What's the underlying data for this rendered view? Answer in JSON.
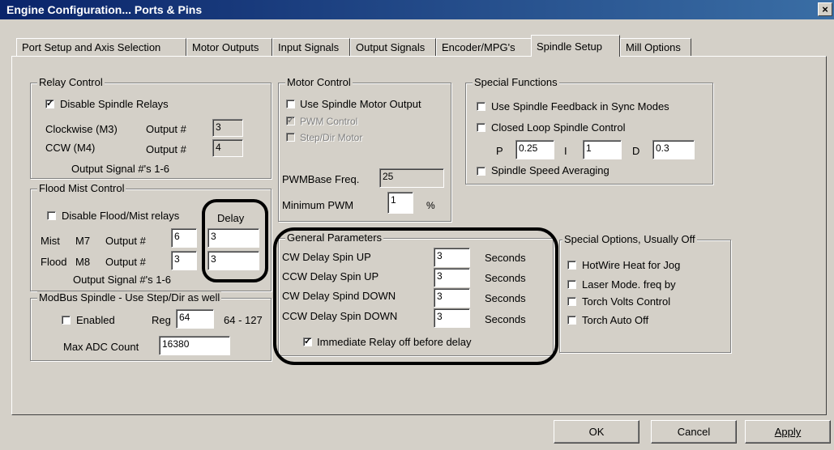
{
  "window": {
    "title": "Engine Configuration... Ports & Pins",
    "close": "×"
  },
  "tabs": [
    {
      "label": "Port Setup and Axis Selection"
    },
    {
      "label": "Motor Outputs"
    },
    {
      "label": "Input Signals"
    },
    {
      "label": "Output Signals"
    },
    {
      "label": "Encoder/MPG's"
    },
    {
      "label": "Spindle Setup"
    },
    {
      "label": "Mill Options"
    }
  ],
  "relay": {
    "title": "Relay Control",
    "disable_label": "Disable Spindle Relays",
    "disable_checked": true,
    "cw_label": "Clockwise (M3)",
    "ccw_label": "CCW (M4)",
    "output_label": "Output #",
    "cw_output": "3",
    "ccw_output": "4",
    "footer": "Output Signal #'s 1-6"
  },
  "flood": {
    "title": "Flood Mist Control",
    "disable_label": "Disable Flood/Mist relays",
    "disable_checked": false,
    "delay_label": "Delay",
    "mist_label": "Mist",
    "mist_code": "M7",
    "flood_label": "Flood",
    "flood_code": "M8",
    "output_label": "Output #",
    "mist_output": "6",
    "flood_output": "3",
    "mist_delay": "3",
    "flood_delay": "3",
    "footer": "Output Signal #'s 1-6"
  },
  "modbus": {
    "title": "ModBus Spindle - Use Step/Dir as well",
    "enabled_label": "Enabled",
    "enabled_checked": false,
    "reg_label": "Reg",
    "reg_value": "64",
    "reg_range": "64 - 127",
    "adc_label": "Max ADC Count",
    "adc_value": "16380"
  },
  "motor": {
    "title": "Motor Control",
    "use_label": "Use Spindle Motor Output",
    "use_checked": false,
    "pwm_label": "PWM Control",
    "pwm_checked": true,
    "stepdir_label": "Step/Dir Motor",
    "stepdir_checked": false,
    "pwmbase_label": "PWMBase Freq.",
    "pwmbase_value": "25",
    "minpwm_label": "Minimum PWM",
    "minpwm_value": "1",
    "minpwm_unit": "%"
  },
  "special": {
    "title": "Special Functions",
    "feedback_label": "Use Spindle Feedback in Sync Modes",
    "feedback_checked": false,
    "closedloop_label": "Closed Loop Spindle Control",
    "closedloop_checked": false,
    "p_label": "P",
    "p_value": "0.25",
    "i_label": "I",
    "i_value": "1",
    "d_label": "D",
    "d_value": "0.3",
    "averaging_label": "Spindle Speed Averaging",
    "averaging_checked": false
  },
  "general": {
    "title": "General Parameters",
    "rows": [
      {
        "label": "CW Delay Spin UP",
        "value": "3",
        "unit": "Seconds"
      },
      {
        "label": "CCW Delay Spin UP",
        "value": "3",
        "unit": "Seconds"
      },
      {
        "label": "CW Delay Spind DOWN",
        "value": "3",
        "unit": "Seconds"
      },
      {
        "label": "CCW Delay Spin DOWN",
        "value": "3",
        "unit": "Seconds"
      }
    ],
    "immediate_label": "Immediate Relay off before delay",
    "immediate_checked": true
  },
  "options": {
    "title": "Special Options, Usually Off",
    "hotwire_label": "HotWire Heat for Jog",
    "hotwire_checked": false,
    "laser_label": "Laser Mode. freq by",
    "laser_checked": false,
    "torchvolts_label": "Torch Volts Control",
    "torchvolts_checked": false,
    "torchoff_label": "Torch Auto Off",
    "torchoff_checked": false
  },
  "buttons": {
    "ok": "OK",
    "cancel": "Cancel",
    "apply": "Apply"
  }
}
